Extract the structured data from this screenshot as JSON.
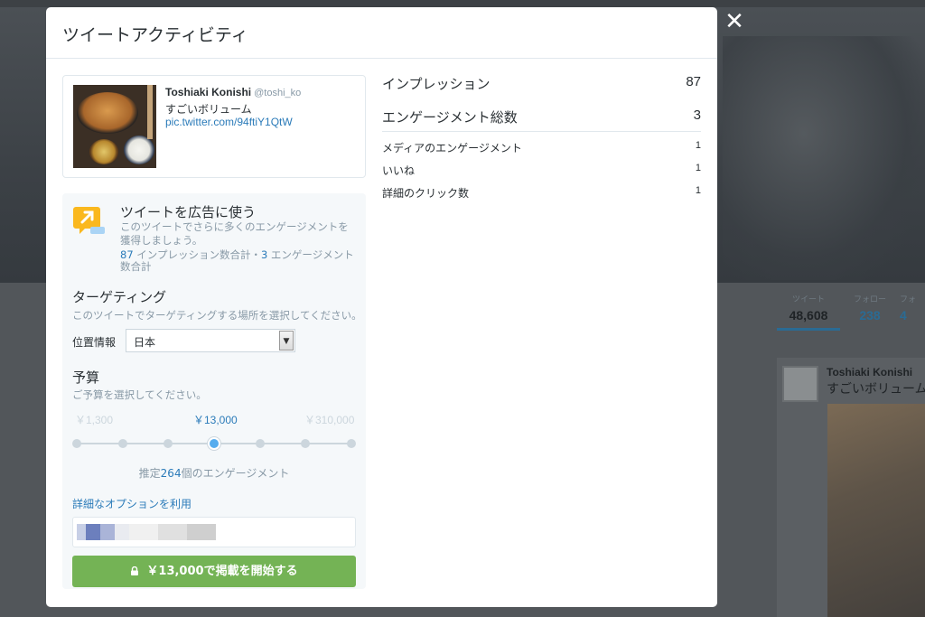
{
  "background": {
    "stats": [
      {
        "label": "ツイート",
        "value": "48,608"
      },
      {
        "label": "フォロー",
        "value": "238"
      },
      {
        "label": "フォ",
        "value": "4"
      }
    ],
    "tweet": {
      "name": "Toshiaki Konishi",
      "text": "すごいボリューム"
    }
  },
  "modal": {
    "title": "ツイートアクティビティ",
    "close_icon": "close-icon"
  },
  "tweet": {
    "name": "Toshiaki Konishi",
    "handle": "@toshi_ko",
    "text": "すごいボリューム",
    "link": "pic.twitter.com/94ftiY1QtW"
  },
  "promote": {
    "title": "ツイートを広告に使う",
    "description": "このツイートでさらに多くのエンゲージメントを獲得しましょう。",
    "impressions": "87",
    "impressions_label": " インプレッション数合計・",
    "engagements": "3",
    "engagements_label": " エンゲージメント数合計",
    "targeting_title": "ターゲティング",
    "targeting_desc": "このツイートでターゲティングする場所を選択してください。",
    "location_label": "位置情報",
    "location_value": "日本",
    "budget_title": "予算",
    "budget_desc": "ご予算を選択してください。",
    "budget_low": "￥1,300",
    "budget_selected": "￥13,000",
    "budget_high": "￥310,000",
    "slider_steps": 7,
    "slider_selected_index": 3,
    "estimate_prefix": "推定",
    "estimate_value": "264",
    "estimate_suffix": "個のエンゲージメント",
    "advanced_link": "詳細なオプションを利用",
    "start_button": "￥13,000で掲載を開始する"
  },
  "metrics": {
    "impressions_label": "インプレッション",
    "impressions_value": "87",
    "engagements_label": "エンゲージメント総数",
    "engagements_value": "3",
    "breakdown": [
      {
        "label": "メディアのエンゲージメント",
        "value": "1"
      },
      {
        "label": "いいね",
        "value": "1"
      },
      {
        "label": "詳細のクリック数",
        "value": "1"
      }
    ]
  },
  "colors": {
    "link": "#2b7bb9",
    "button": "#74b355",
    "slider_active": "#55acee"
  }
}
